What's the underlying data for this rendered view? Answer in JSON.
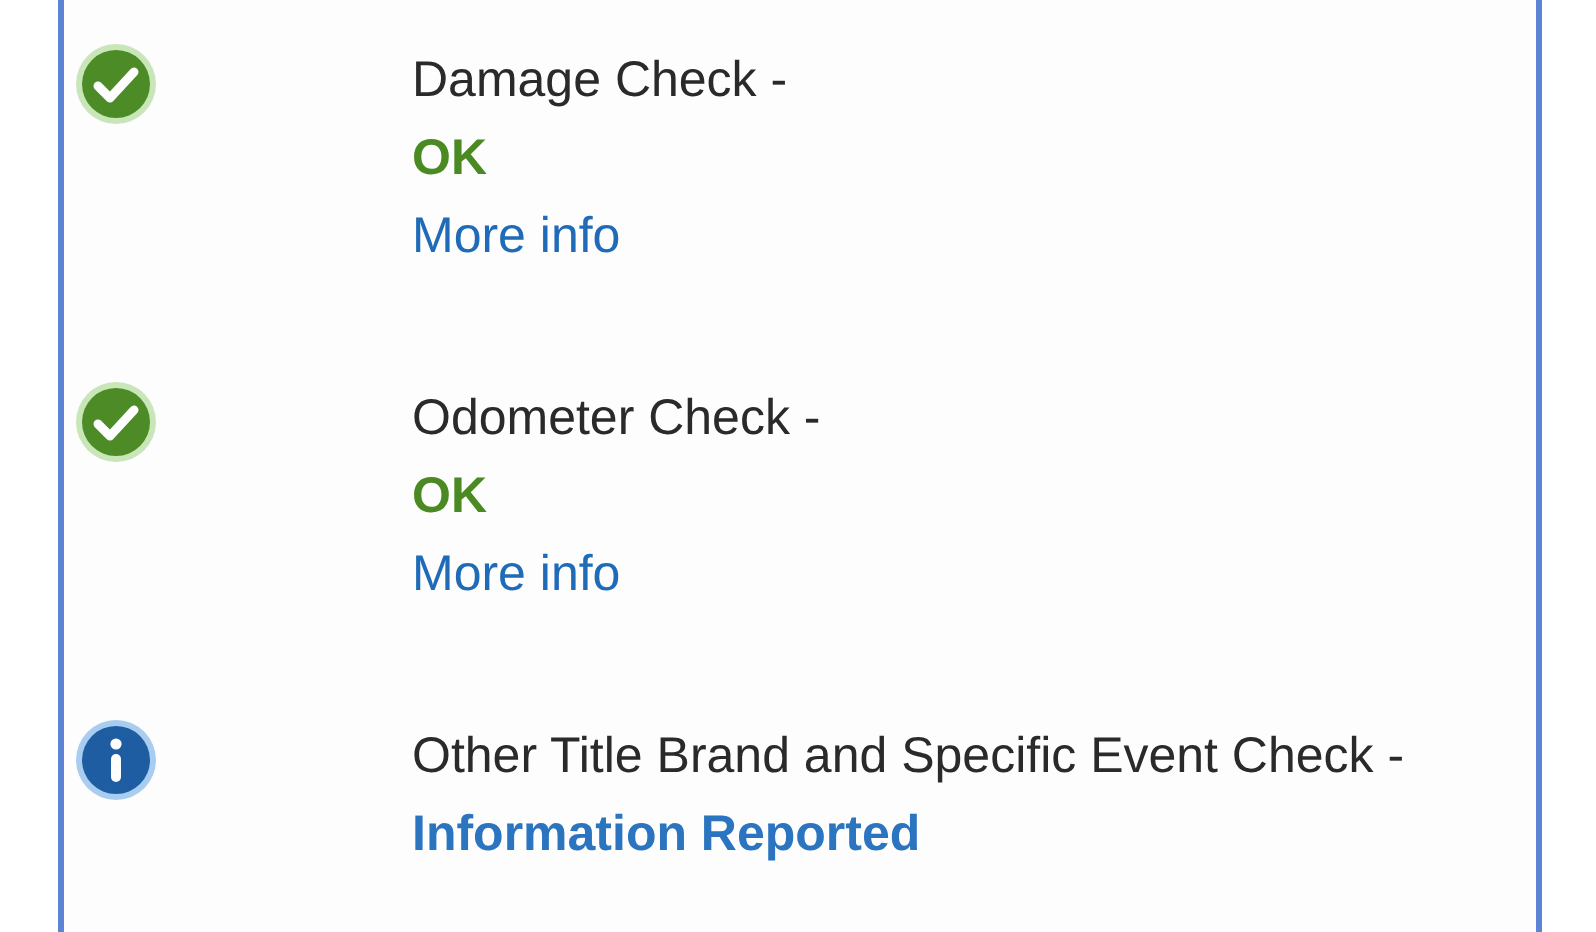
{
  "checks": [
    {
      "title": "Damage Check -",
      "status": {
        "text": "OK",
        "kind": "ok"
      },
      "link": "More info"
    },
    {
      "title": "Odometer Check -",
      "status": {
        "text": "OK",
        "kind": "ok"
      },
      "link": "More info"
    },
    {
      "title": "Other Title Brand and Specific Event Check -",
      "status": {
        "text": "Information Reported",
        "kind": "info"
      }
    }
  ]
}
